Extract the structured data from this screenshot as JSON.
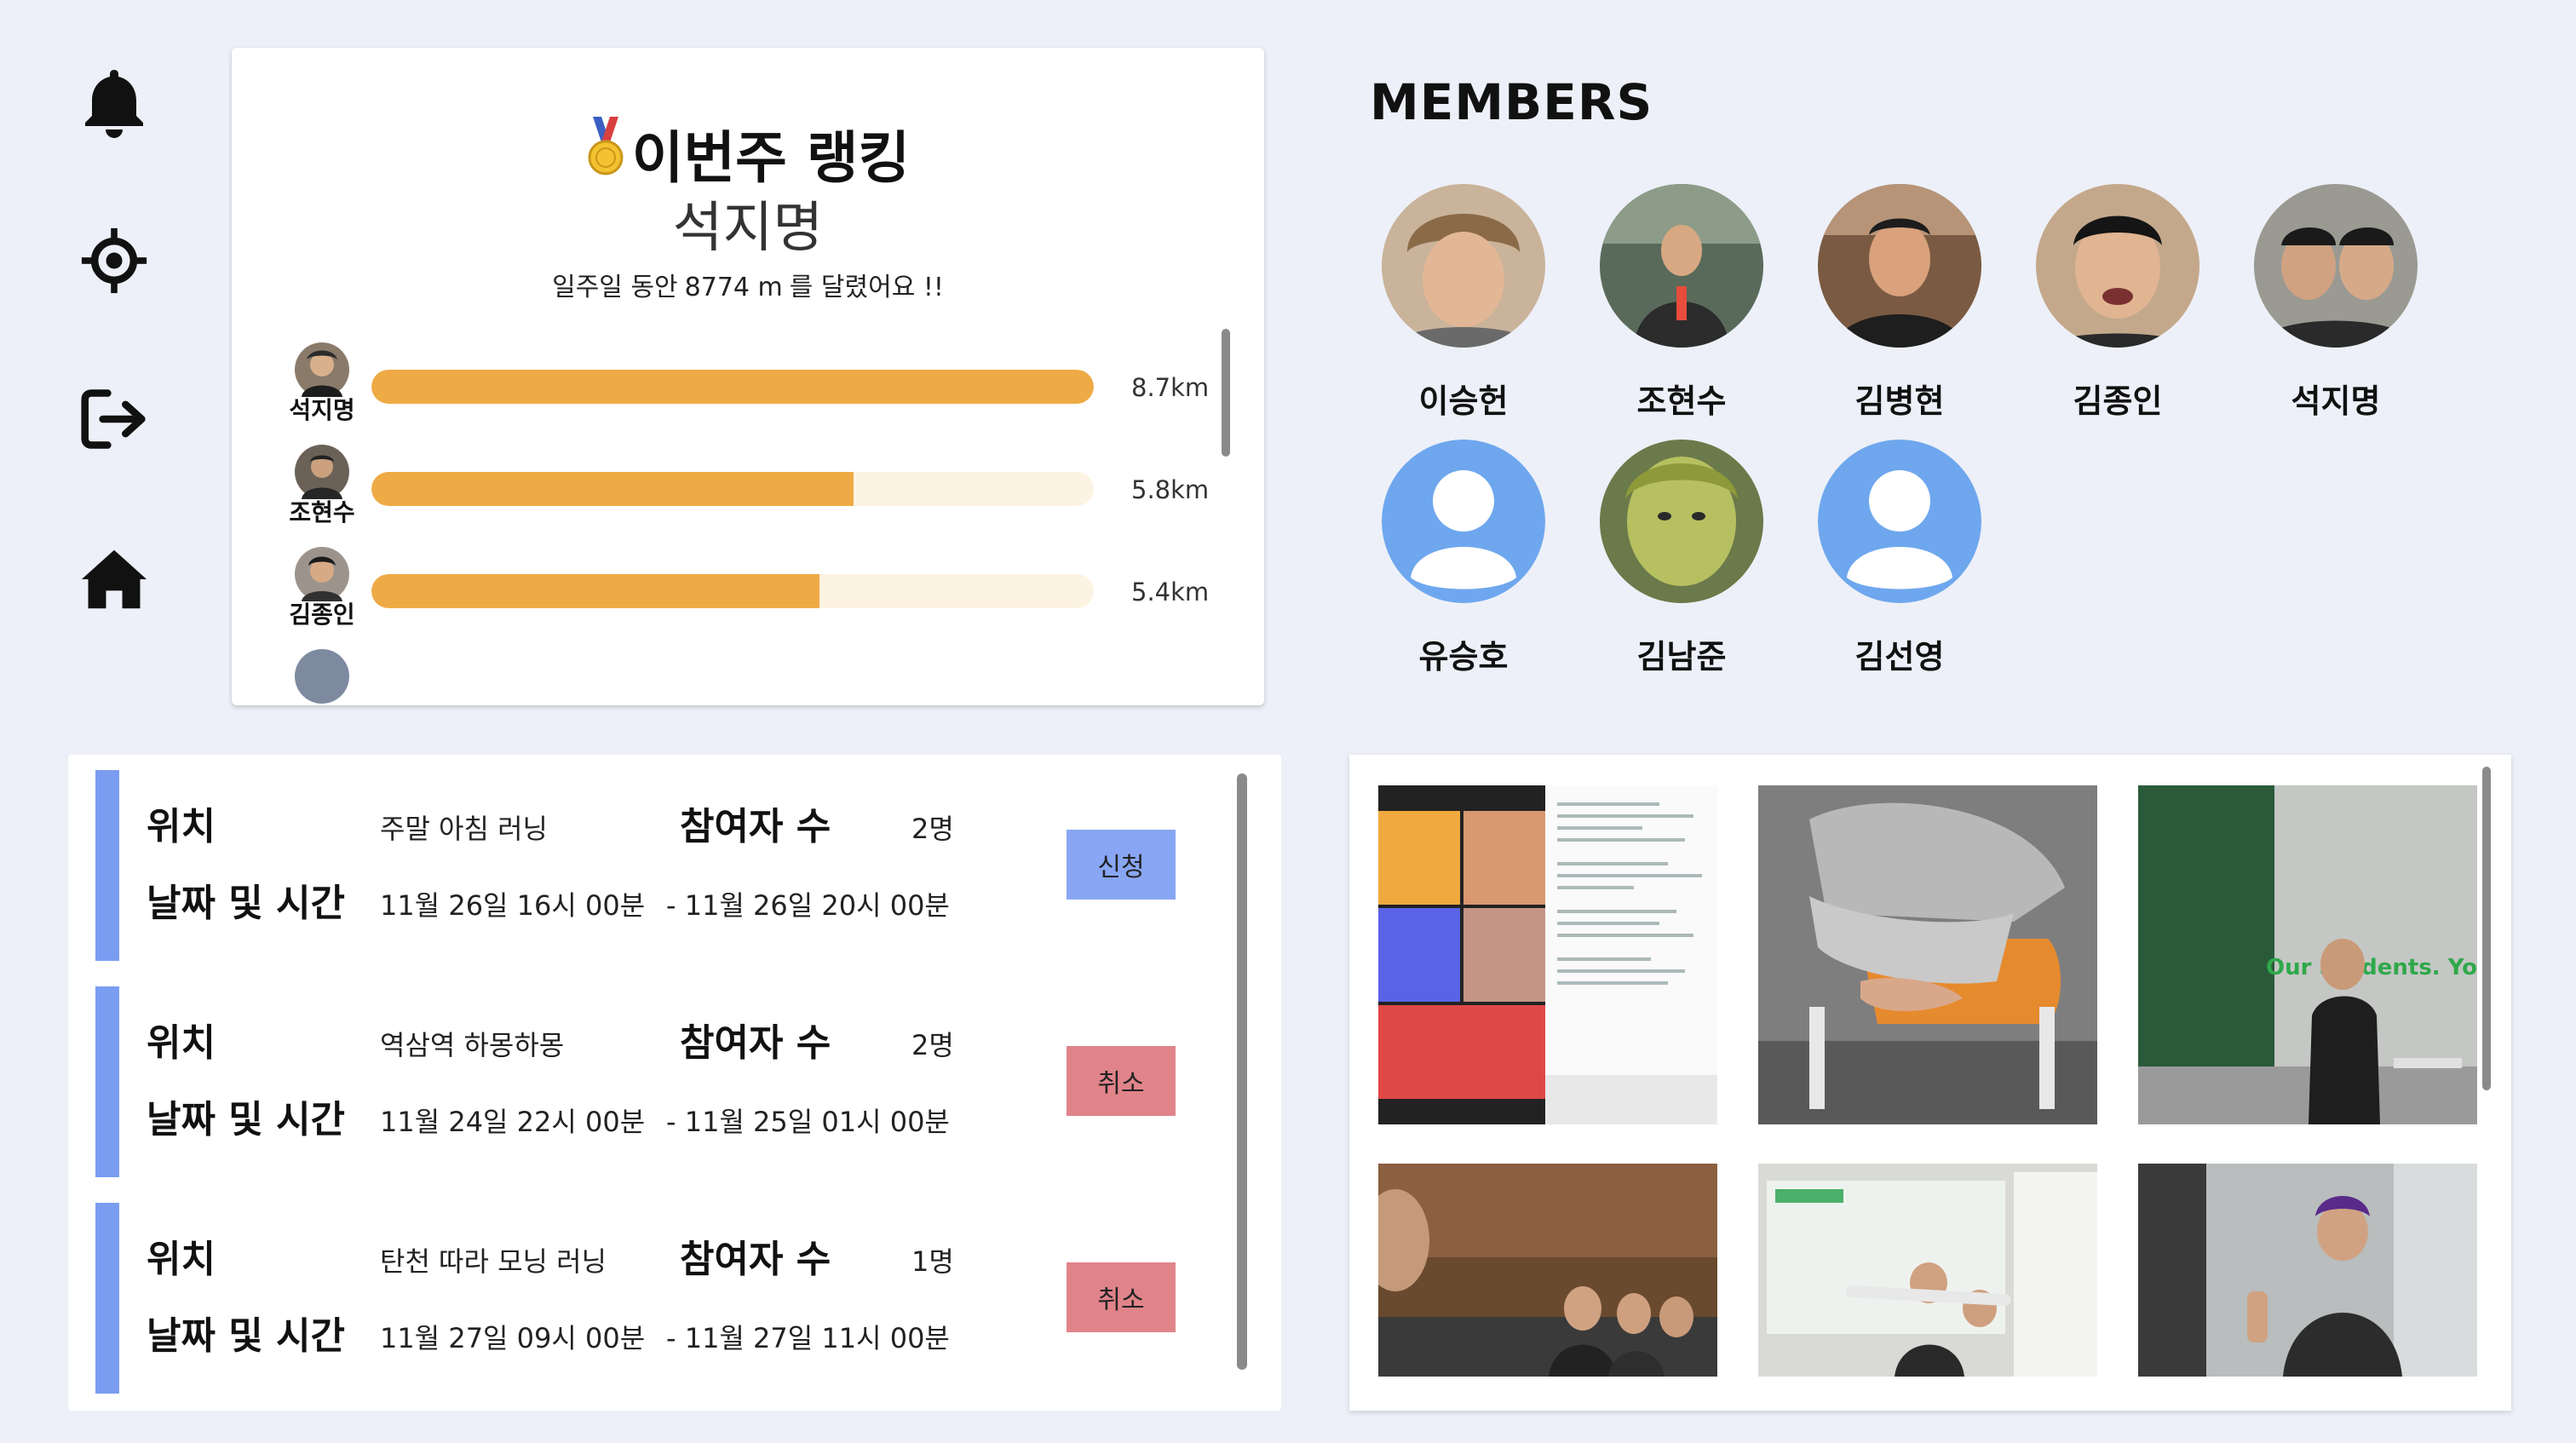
{
  "sidebar": {
    "items": [
      {
        "icon": "bell-icon",
        "label": "notifications"
      },
      {
        "icon": "target-icon",
        "label": "location"
      },
      {
        "icon": "logout-icon",
        "label": "logout"
      },
      {
        "icon": "home-icon",
        "label": "home"
      }
    ]
  },
  "ranking": {
    "title": "이번주 랭킹",
    "medal_icon": "medal-icon",
    "winner": "석지명",
    "summary_prefix": "일주일 동안",
    "summary_distance": "8774 m",
    "summary_suffix": "를 달렸어요 !!",
    "bar_color": "#eeab45",
    "track_color": "#fdf3e3",
    "rows": [
      {
        "name": "석지명",
        "value": "8.7km",
        "fraction": 1.0
      },
      {
        "name": "조현수",
        "value": "5.8km",
        "fraction": 0.667
      },
      {
        "name": "김종인",
        "value": "5.4km",
        "fraction": 0.62
      }
    ]
  },
  "members": {
    "title": "MEMBERS",
    "list": [
      {
        "name": "이승헌",
        "avatar": "photo"
      },
      {
        "name": "조현수",
        "avatar": "photo"
      },
      {
        "name": "김병현",
        "avatar": "photo"
      },
      {
        "name": "김종인",
        "avatar": "photo"
      },
      {
        "name": "석지명",
        "avatar": "photo"
      },
      {
        "name": "유승호",
        "avatar": "default-user-icon"
      },
      {
        "name": "김남준",
        "avatar": "photo"
      },
      {
        "name": "김선영",
        "avatar": "default-user-icon"
      }
    ]
  },
  "schedules": {
    "location_label": "위치",
    "datetime_label": "날짜 및 시간",
    "participants_label": "참여자 수",
    "accent_color": "#7b9df1",
    "items": [
      {
        "location": "주말 아침 러닝",
        "participants": "2명",
        "start": "11월 26일 16시 00분",
        "end": "- 11월 26일 20시 00분",
        "action": "신청",
        "action_type": "apply"
      },
      {
        "location": "역삼역 하몽하몽",
        "participants": "2명",
        "start": "11월 24일 22시 00분",
        "end": "- 11월 25일 01시 00분",
        "action": "취소",
        "action_type": "cancel"
      },
      {
        "location": "탄천 따라 모닝 러닝",
        "participants": "1명",
        "start": "11월 27일 09시 00분",
        "end": "- 11월 27일 11시 00분",
        "action": "취소",
        "action_type": "cancel"
      }
    ]
  },
  "gallery": {
    "overlay_text": "Our Students. You",
    "photos": [
      "photo-1",
      "photo-2",
      "photo-3",
      "photo-4",
      "photo-5",
      "photo-6"
    ]
  }
}
